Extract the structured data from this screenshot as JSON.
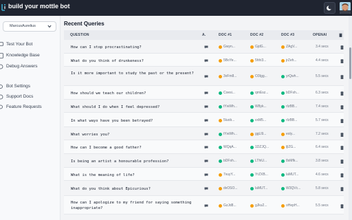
{
  "app": {
    "title": "build your mottle bot"
  },
  "sidebar": {
    "user": "MarcusAurelius",
    "items": [
      {
        "label": "Test Your Bot",
        "icon": "chat-icon"
      },
      {
        "label": "Knowledge Base",
        "icon": "book-icon"
      },
      {
        "label": "Debug Answers",
        "icon": "bug-icon"
      },
      {
        "label": "Bot Settings",
        "icon": "gear-icon"
      },
      {
        "label": "Support Docs",
        "icon": "question-icon"
      },
      {
        "label": "Feature Requests",
        "icon": "lightbulb-icon"
      }
    ]
  },
  "main": {
    "title": "Recent Queries",
    "columns": [
      "QUESTION",
      "A.",
      "DOC #1",
      "DOC #2",
      "DOC #3",
      "OPENAI",
      ""
    ],
    "status_colors": {
      "orange": "#f59e0b",
      "green": "#10b981"
    },
    "rows": [
      {
        "question": "How can I stop procrastinating?",
        "docs": [
          [
            "orange",
            "Gwyn..."
          ],
          [
            "orange",
            "GjdG..."
          ],
          [
            "orange",
            "ZAgV..."
          ]
        ],
        "time": "3.4 secs"
      },
      {
        "question": "What do you think of drunkeness?",
        "docs": [
          [
            "orange",
            "5BoYe..."
          ],
          [
            "orange",
            "5hhi3..."
          ],
          [
            "orange",
            "jrZeh..."
          ]
        ],
        "time": "4.4 secs"
      },
      {
        "question": "Is it more important to study the past or the present?",
        "docs": [
          [
            "orange",
            "3vFm8..."
          ],
          [
            "orange",
            "O3Igg..."
          ],
          [
            "green",
            "yrQwh..."
          ]
        ],
        "time": "5.5 secs"
      },
      {
        "question": "How should we teach our children?",
        "docs": [
          [
            "green",
            "Coesi..."
          ],
          [
            "green",
            "qmEsz..."
          ],
          [
            "green",
            "bDFsh..."
          ]
        ],
        "time": "6.3 secs"
      },
      {
        "question": "What should I do when I feel depressed?",
        "docs": [
          [
            "green",
            "tYwWh..."
          ],
          [
            "green",
            "W8yk..."
          ],
          [
            "green",
            "rIzBB..."
          ]
        ],
        "time": "7.4 secs"
      },
      {
        "question": "In what ways have you been betrayed?",
        "docs": [
          [
            "orange",
            "5luob..."
          ],
          [
            "green",
            "vxM5..."
          ],
          [
            "green",
            "rIzBB..."
          ]
        ],
        "time": "5.7 secs"
      },
      {
        "question": "What worries you?",
        "docs": [
          [
            "green",
            "tYwWh..."
          ],
          [
            "orange",
            "ggLl9..."
          ],
          [
            "orange",
            "eoly..."
          ]
        ],
        "time": "7.2 secs"
      },
      {
        "question": "How can I become a good father?",
        "docs": [
          [
            "green",
            "WQqA..."
          ],
          [
            "green",
            "1DZJQ..."
          ],
          [
            "orange",
            "ljlZG..."
          ]
        ],
        "time": "6.4 secs"
      },
      {
        "question": "Is being an artist a honourable profession?",
        "docs": [
          [
            "green",
            "bDFsh..."
          ],
          [
            "green",
            "LThiU..."
          ],
          [
            "green",
            "8sMfk..."
          ]
        ],
        "time": "3.8 secs"
      },
      {
        "question": "What is the meaning of life?",
        "docs": [
          [
            "orange",
            "7vuyY..."
          ],
          [
            "green",
            "YrZXB..."
          ],
          [
            "green",
            "laMUT..."
          ]
        ],
        "time": "4.6 secs"
      },
      {
        "question": "What do you think about Epicurious?",
        "docs": [
          [
            "orange",
            "dvOSO..."
          ],
          [
            "green",
            "laMUT..."
          ],
          [
            "green",
            "W3QVc..."
          ]
        ],
        "time": "5.8 secs"
      },
      {
        "question": "How can I apologize to my friend for saying something inappropriate?",
        "docs": [
          [
            "orange",
            "GzJd8..."
          ],
          [
            "orange",
            "gJku2..."
          ],
          [
            "orange",
            "oHepH..."
          ]
        ],
        "time": "5.5 secs"
      }
    ]
  }
}
